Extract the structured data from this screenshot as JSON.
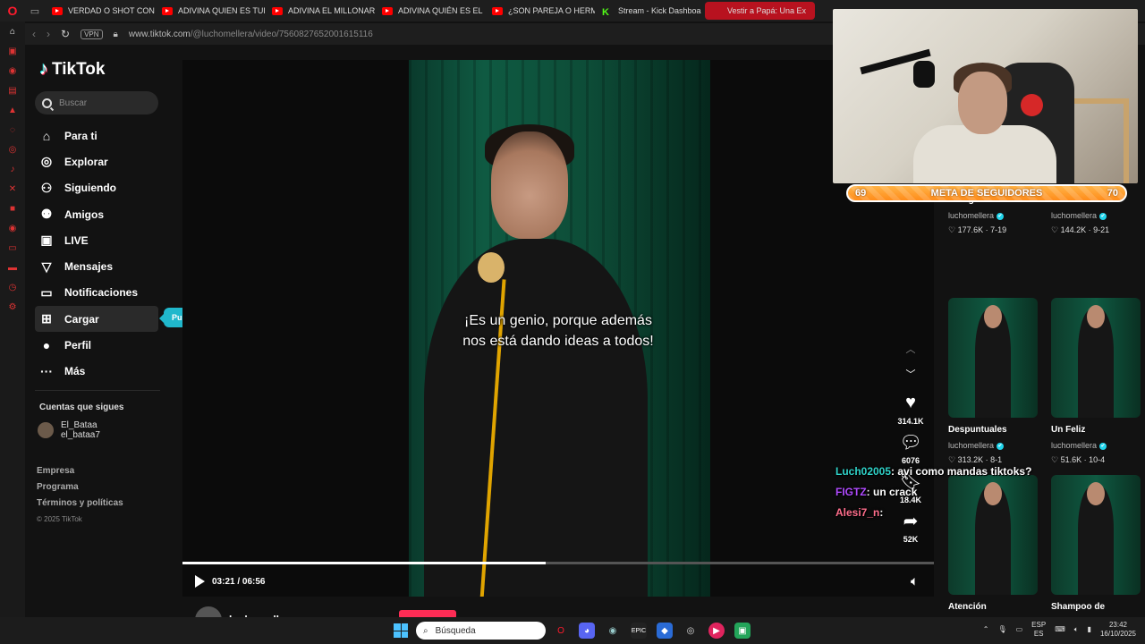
{
  "browser": {
    "tabs": [
      {
        "label": "VERDAD O SHOT CON F",
        "type": "yt"
      },
      {
        "label": "ADIVINA QUIEN ES TUR",
        "type": "yt"
      },
      {
        "label": "ADIVINA EL MILLONARI",
        "type": "yt"
      },
      {
        "label": "ADIVINA QUIÉN ES EL C",
        "type": "yt"
      },
      {
        "label": "¿SON PAREJA O HERMA",
        "type": "yt"
      },
      {
        "label": "Stream - Kick Dashboa",
        "type": "kick"
      },
      {
        "label": "Vestir a Papá: Una Ex",
        "type": "tt",
        "active": true
      }
    ],
    "vpn_label": "VPN",
    "url_host": "www.tiktok.com",
    "url_path": "/@luchomellera/video/7560827652001615116"
  },
  "tiktok": {
    "logo": "TikTok",
    "search_placeholder": "Buscar",
    "nav": [
      {
        "label": "Para ti",
        "icon": "home-icon",
        "glyph": "⌂"
      },
      {
        "label": "Explorar",
        "icon": "compass-icon",
        "glyph": "◎"
      },
      {
        "label": "Siguiendo",
        "icon": "user-follow-icon",
        "glyph": "⚇"
      },
      {
        "label": "Amigos",
        "icon": "friends-icon",
        "glyph": "⚉"
      },
      {
        "label": "LIVE",
        "icon": "live-icon",
        "glyph": "▣"
      },
      {
        "label": "Mensajes",
        "icon": "messages-icon",
        "glyph": "▽"
      },
      {
        "label": "Notificaciones",
        "icon": "notifications-icon",
        "glyph": "▭"
      },
      {
        "label": "Cargar",
        "icon": "upload-icon",
        "glyph": "⊞"
      },
      {
        "label": "Perfil",
        "icon": "profile-icon",
        "glyph": "●"
      },
      {
        "label": "Más",
        "icon": "more-icon",
        "glyph": "···"
      }
    ],
    "upload_tooltip": "Publicar video",
    "following_title": "Cuentas que sigues",
    "following": {
      "name": "El_Bataa",
      "handle": "el_bataa7"
    },
    "footer": [
      "Empresa",
      "Programa",
      "Términos y políticas"
    ],
    "copyright": "© 2025 TikTok",
    "video": {
      "subtitle_line1": "¡Es un genio, porque además",
      "subtitle_line2": "nos está dando ideas a todos!",
      "time": "03:21 / 06:56",
      "progress": 0.483,
      "author": "luchomellera"
    },
    "actions": {
      "likes": "314.1K",
      "comments": "6076",
      "saves": "18.4K",
      "shares": "52K"
    },
    "grid": [
      {
        "title": "Testigo de Navidad",
        "author": "luchomellera",
        "stats": "♡ 177.6K · 7-19"
      },
      {
        "title": "Silencio Matinal",
        "author": "luchomellera",
        "stats": "♡ 144.2K · 9-21"
      },
      {
        "title": "Despuntuales",
        "author": "luchomellera",
        "stats": "♡ 313.2K · 8-1"
      },
      {
        "title": "Un Feliz",
        "author": "luchomellera",
        "stats": "♡ 51.6K · 10-4"
      },
      {
        "title": "Atención",
        "author": "",
        "stats": ""
      },
      {
        "title": "Shampoo de",
        "author": "",
        "stats": ""
      }
    ]
  },
  "stream": {
    "goal_label": "META DE SEGUIDORES",
    "goal_current": "69",
    "goal_target": "70",
    "chat": [
      {
        "user": "Luch02005",
        "msg": ": avi como mandas tiktoks?"
      },
      {
        "user": "FIGTZ",
        "msg": ": un crack"
      },
      {
        "user": "Alesi7_n",
        "msg": ":"
      }
    ]
  },
  "taskbar": {
    "search_placeholder": "Búsqueda",
    "lang_top": "ESP",
    "lang_bottom": "ES",
    "time": "23:42",
    "date": "16/10/2025"
  }
}
